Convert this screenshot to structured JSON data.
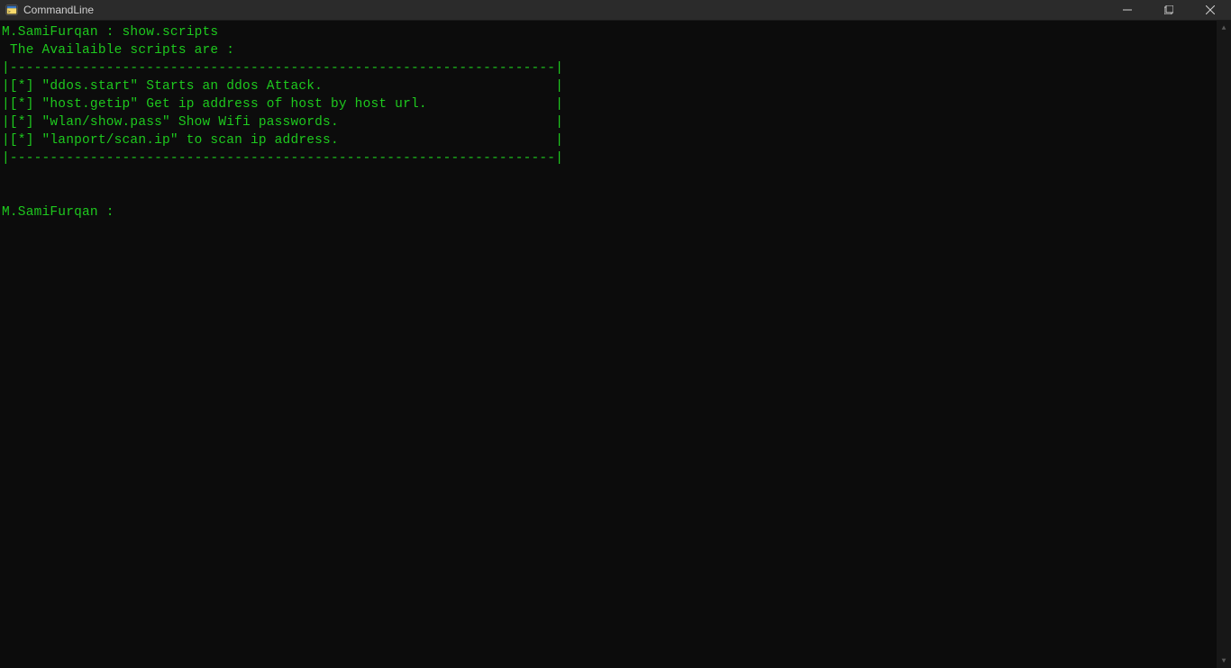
{
  "window": {
    "title": "CommandLine"
  },
  "terminal": {
    "line1": "M.SamiFurqan : show.scripts",
    "line2": " The Availaible scripts are :",
    "line3": "|--------------------------------------------------------------------|",
    "line4": "|[*] \"ddos.start\" Starts an ddos Attack.                             |",
    "line5": "|[*] \"host.getip\" Get ip address of host by host url.                |",
    "line6": "|[*] \"wlan/show.pass\" Show Wifi passwords.                           |",
    "line7": "|[*] \"lanport/scan.ip\" to scan ip address.                           |",
    "line8": "|--------------------------------------------------------------------|",
    "line9": "",
    "line10": "",
    "line11": "M.SamiFurqan : "
  }
}
